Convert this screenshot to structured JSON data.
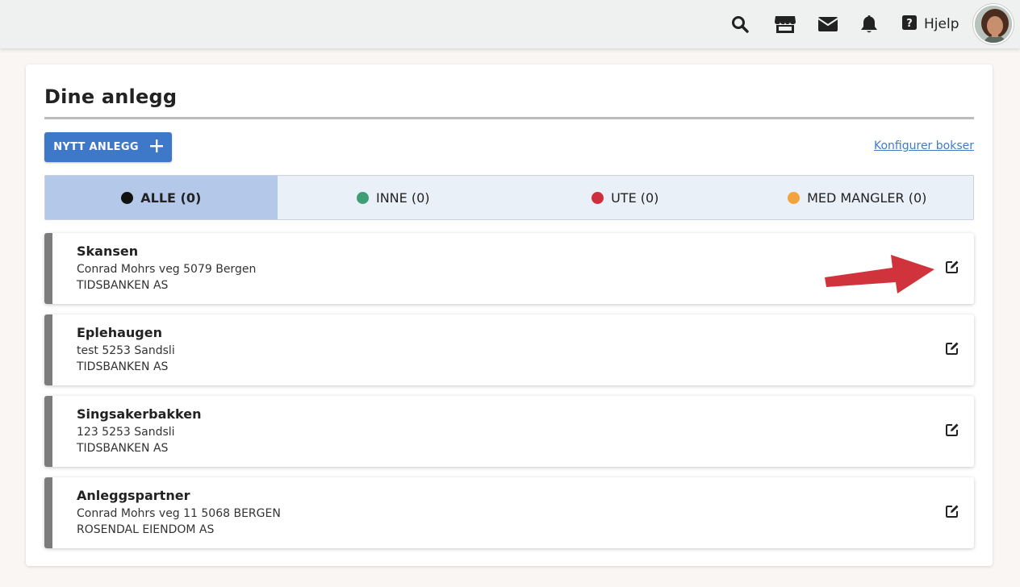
{
  "header": {
    "help_label": "Hjelp",
    "icons": [
      "search-icon",
      "store-icon",
      "mail-icon",
      "bell-icon",
      "help-icon"
    ]
  },
  "page": {
    "title": "Dine anlegg",
    "new_button_label": "NYTT ANLEGG",
    "config_link": "Konfigurer bokser"
  },
  "filters": [
    {
      "label": "ALLE (0)",
      "color": "#111111",
      "active": true
    },
    {
      "label": "INNE (0)",
      "color": "#3f9e74",
      "active": false
    },
    {
      "label": "UTE (0)",
      "color": "#cf2f3a",
      "active": false
    },
    {
      "label": "MED MANGLER (0)",
      "color": "#f3a33d",
      "active": false
    }
  ],
  "facilities": [
    {
      "name": "Skansen",
      "address": "Conrad Mohrs veg 5079 Bergen",
      "owner": "TIDSBANKEN AS"
    },
    {
      "name": "Eplehaugen",
      "address": "test 5253 Sandsli",
      "owner": "TIDSBANKEN AS"
    },
    {
      "name": "Singsakerbakken",
      "address": "123 5253 Sandsli",
      "owner": "TIDSBANKEN AS"
    },
    {
      "name": "Anleggspartner",
      "address": "Conrad Mohrs veg 11 5068 BERGEN",
      "owner": "ROSENDAL EIENDOM AS"
    }
  ],
  "colors": {
    "accent": "#3e78c8",
    "status_bar": "#7c7c7c",
    "annotation_arrow": "#d0333b"
  }
}
